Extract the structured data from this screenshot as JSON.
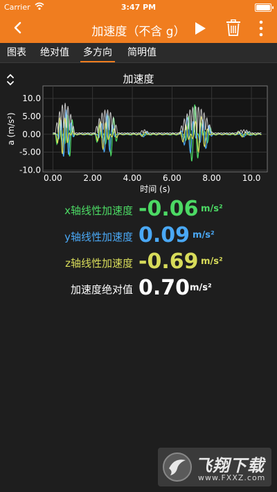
{
  "status_bar": {
    "carrier": "Carrier",
    "time": "3:47 PM"
  },
  "nav": {
    "title": "加速度（不含 g）"
  },
  "tabs": [
    {
      "label": "图表",
      "active": false
    },
    {
      "label": "绝对值",
      "active": false
    },
    {
      "label": "多方向",
      "active": true
    },
    {
      "label": "简明值",
      "active": false
    }
  ],
  "chart_data": {
    "type": "line",
    "title": "加速度",
    "xlabel": "时间 (s)",
    "ylabel": "a (m/s²)",
    "xlim": [
      -0.5,
      10.8
    ],
    "ylim": [
      -10.5,
      13.5
    ],
    "x_ticks": [
      "0.00",
      "2.00",
      "4.00",
      "6.00",
      "8.00",
      "10.0"
    ],
    "y_ticks": [
      "10.0",
      "5.00",
      "0.00",
      "-5.00",
      "-10.0"
    ],
    "grid": true,
    "series": [
      {
        "color": "#4cd964",
        "role": "x"
      },
      {
        "color": "#4aa8f5",
        "role": "y"
      },
      {
        "color": "#d8dc5a",
        "role": "z"
      },
      {
        "color": "#e6e6e6",
        "role": "abs"
      }
    ],
    "bursts": [
      {
        "center": 0.6,
        "width": 1.0,
        "amp": 9.5,
        "freq": 12
      },
      {
        "center": 2.7,
        "width": 1.2,
        "amp": 7.5,
        "freq": 11
      },
      {
        "center": 4.6,
        "width": 0.5,
        "amp": 1.2,
        "freq": 9
      },
      {
        "center": 7.2,
        "width": 1.7,
        "amp": 8.5,
        "freq": 10
      },
      {
        "center": 9.6,
        "width": 0.9,
        "amp": 1.2,
        "freq": 9
      }
    ]
  },
  "readouts": [
    {
      "label": "x轴线性加速度",
      "value": "-0.06",
      "unit": "m/s²",
      "color": "#4cd964"
    },
    {
      "label": "y轴线性加速度",
      "value": "0.09",
      "unit": "m/s²",
      "color": "#4aa8f5"
    },
    {
      "label": "z轴线性加速度",
      "value": "-0.69",
      "unit": "m/s²",
      "color": "#d8dc5a"
    },
    {
      "label": "加速度绝对值",
      "value": "0.70",
      "unit": "m/s²",
      "color": "#ffffff"
    }
  ],
  "watermark": {
    "name": "飞翔下载",
    "url": "www.FXXZ.com"
  },
  "colors": {
    "accent": "#f07d1f",
    "background": "#1e1e1e"
  }
}
